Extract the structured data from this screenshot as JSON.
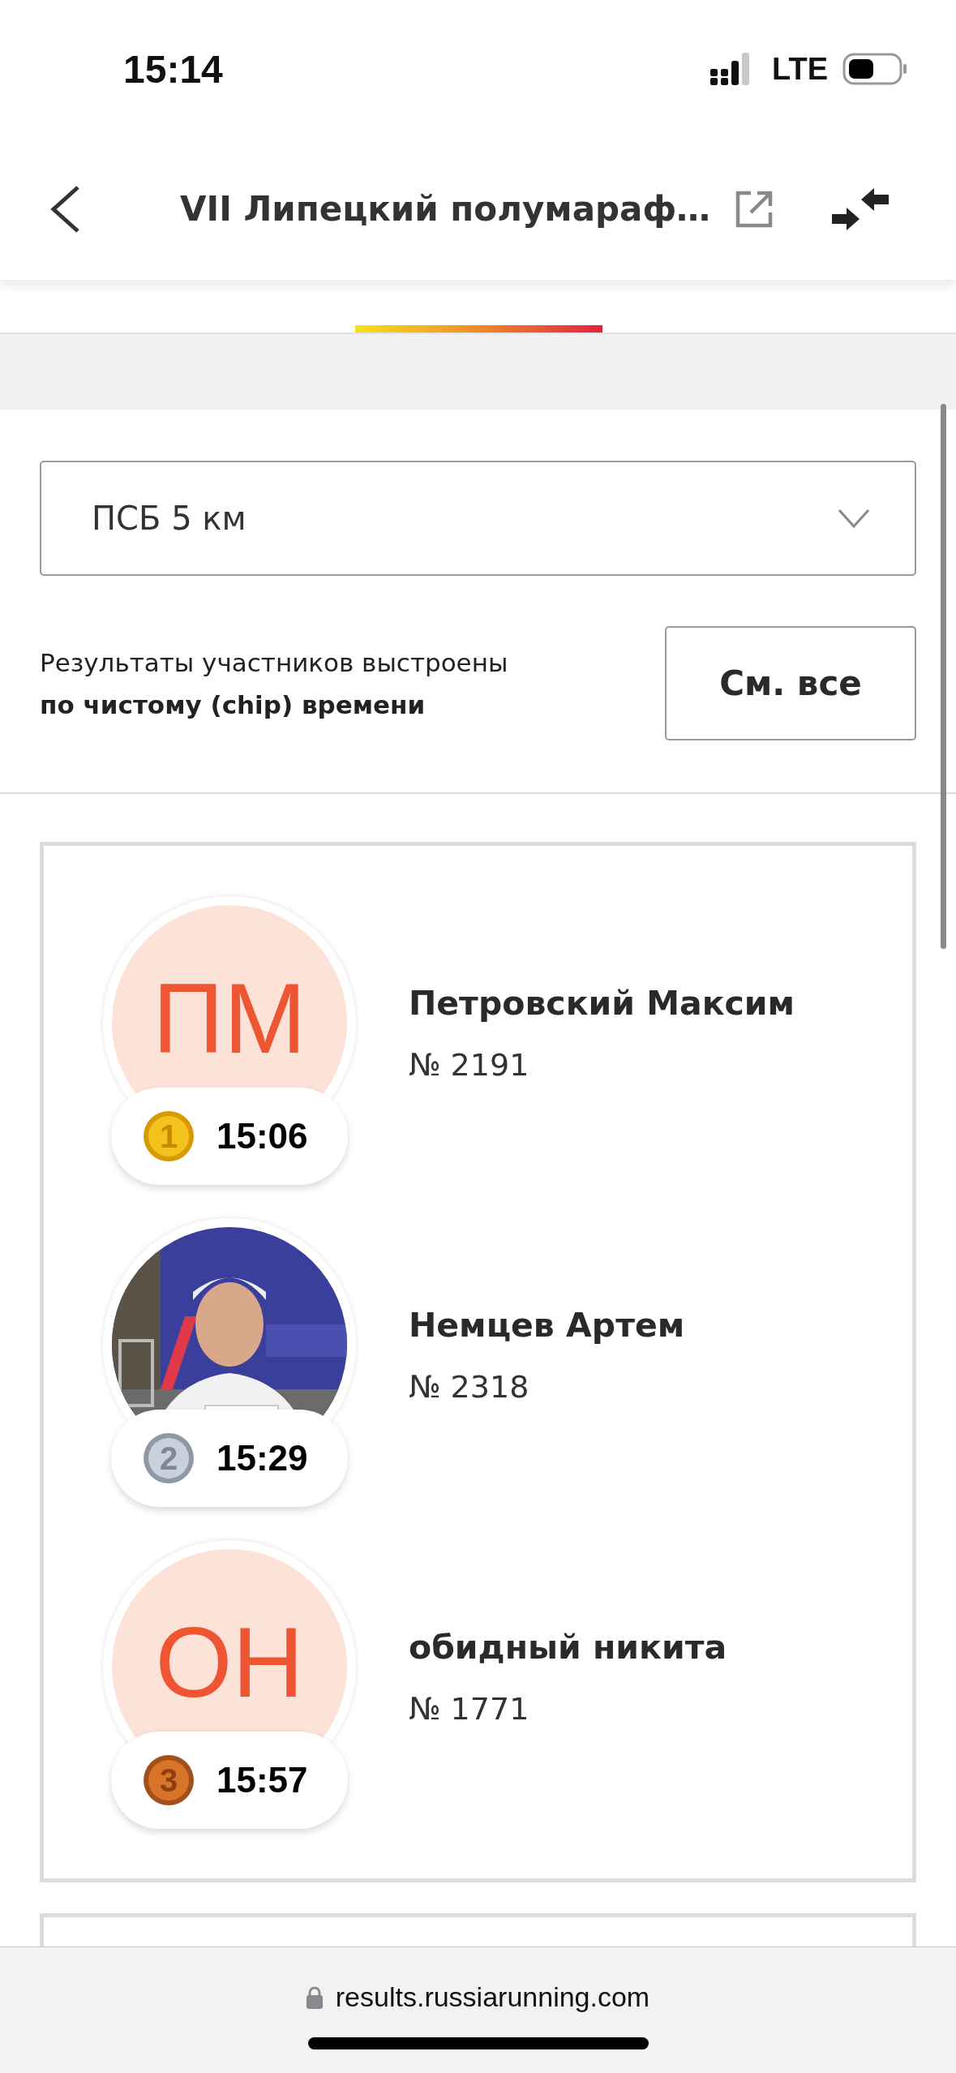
{
  "status_bar": {
    "time": "15:14",
    "network": "LTE"
  },
  "header": {
    "title": "VII Липецкий полумараф…"
  },
  "distance_select": {
    "value": "ПСБ 5 км"
  },
  "sort_note": "Результаты участников выстроены **по чистому (chip) времени**",
  "see_all_button": "См. все",
  "results": [
    {
      "kind": "initials",
      "initials": "ПМ",
      "place": "1",
      "time": "15:06",
      "name": "Петровский Максим",
      "bib": "№ 2191"
    },
    {
      "place": "2",
      "time": "15:29",
      "name": "Немцев Артем",
      "bib": "№ 2318"
    },
    {
      "kind": "initials",
      "initials": "ОН",
      "place": "3",
      "time": "15:57",
      "name": "обидный никита",
      "bib": "№ 1771"
    }
  ],
  "address_bar": {
    "url": "results.russiarunning.com"
  }
}
